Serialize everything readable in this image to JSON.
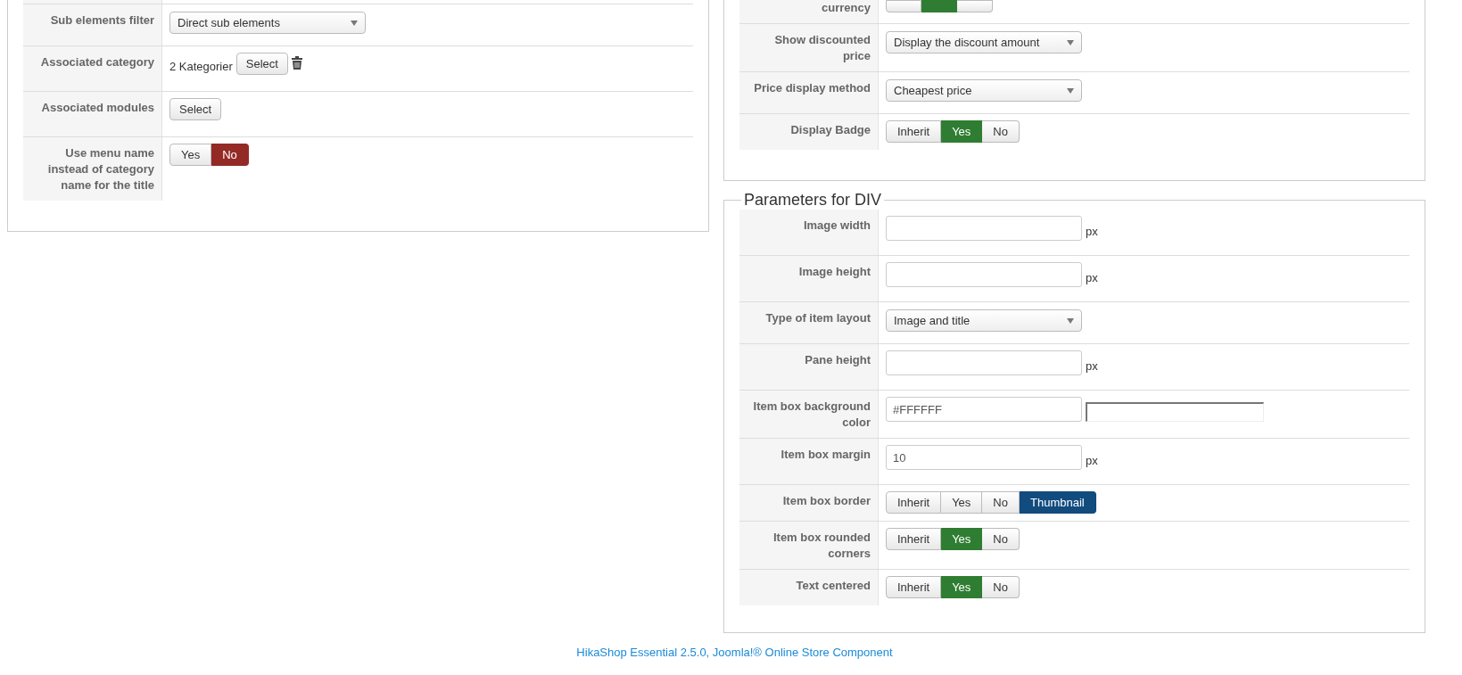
{
  "left_panel": {
    "rows": [
      {
        "kind": "empty"
      },
      {
        "kind": "select",
        "label": "Sub elements filter",
        "value": "Direct sub elements"
      },
      {
        "kind": "category",
        "label": "Associated category",
        "text": "2 Kategorier",
        "button": "Select"
      },
      {
        "kind": "button",
        "label": "Associated modules",
        "button": "Select"
      },
      {
        "kind": "toggle",
        "label": "Use menu name instead of category name for the title",
        "options": [
          {
            "label": "Yes",
            "kind": "yes",
            "selected": false
          },
          {
            "label": "No",
            "kind": "no",
            "selected": true
          }
        ]
      }
    ]
  },
  "right_panel": {
    "rows": [
      {
        "kind": "cut_toggle",
        "label": "currency",
        "options": [
          {
            "kind": "inherit",
            "selected": false
          },
          {
            "kind": "yes",
            "selected": true
          },
          {
            "kind": "no",
            "selected": false
          }
        ]
      },
      {
        "kind": "select",
        "label": "Show discounted price",
        "value": "Display the discount amount"
      },
      {
        "kind": "select",
        "label": "Price display method",
        "value": "Cheapest price"
      },
      {
        "kind": "toggle",
        "label": "Display Badge",
        "options": [
          {
            "label": "Inherit",
            "kind": "inherit",
            "selected": false
          },
          {
            "label": "Yes",
            "kind": "yes",
            "selected": true
          },
          {
            "label": "No",
            "kind": "no",
            "selected": false
          }
        ]
      }
    ]
  },
  "div_parameters": {
    "title": "Parameters for DIV",
    "rows": [
      {
        "kind": "input",
        "label": "Image width",
        "unit": "px"
      },
      {
        "kind": "input",
        "label": "Image height",
        "unit": "px"
      },
      {
        "kind": "select",
        "label": "Type of item layout",
        "value": "Image and title"
      },
      {
        "kind": "input",
        "label": "Pane height",
        "unit": "px"
      },
      {
        "kind": "color",
        "label": "Item box background color",
        "value": "#FFFFFF"
      },
      {
        "kind": "input",
        "label": "Item box margin",
        "value": "10",
        "unit": "px"
      },
      {
        "kind": "toggle",
        "label": "Item box border",
        "options": [
          {
            "label": "Inherit",
            "kind": "inherit",
            "selected": false
          },
          {
            "label": "Yes",
            "kind": "yes",
            "selected": false
          },
          {
            "label": "No",
            "kind": "no",
            "selected": false
          },
          {
            "label": "Thumbnail",
            "kind": "other",
            "selected": true
          }
        ]
      },
      {
        "kind": "toggle",
        "label": "Item box rounded corners",
        "options": [
          {
            "label": "Inherit",
            "kind": "inherit",
            "selected": false
          },
          {
            "label": "Yes",
            "kind": "yes",
            "selected": true
          },
          {
            "label": "No",
            "kind": "no",
            "selected": false
          }
        ]
      },
      {
        "kind": "toggle",
        "label": "Text centered",
        "options": [
          {
            "label": "Inherit",
            "kind": "inherit",
            "selected": false
          },
          {
            "label": "Yes",
            "kind": "yes",
            "selected": true
          },
          {
            "label": "No",
            "kind": "no",
            "selected": false
          }
        ]
      }
    ]
  },
  "footer": {
    "text": "HikaShop Essential 2.5.0, Joomla!® Online Store Component"
  }
}
